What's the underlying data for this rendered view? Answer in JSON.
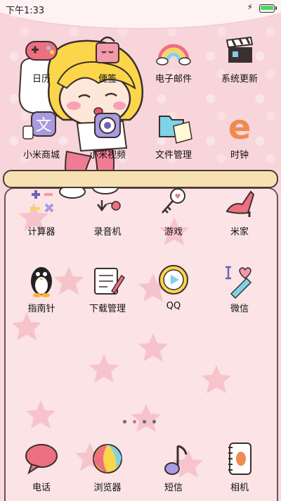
{
  "status_bar": {
    "time": "下午1:33",
    "battery_level": 1.0,
    "charging_icon": "flash-icon"
  },
  "apps_top": [
    {
      "label": "日历",
      "icon": "gamepad-icon"
    },
    {
      "label": "便签",
      "icon": "shopping-bag-icon"
    },
    {
      "label": "电子邮件",
      "icon": "rainbow-icon"
    },
    {
      "label": "系统更新",
      "icon": "clapperboard-icon"
    },
    {
      "label": "小米商城",
      "icon": "translate-icon"
    },
    {
      "label": "小米视频",
      "icon": "camera-icon"
    },
    {
      "label": "文件管理",
      "icon": "folder-icon"
    },
    {
      "label": "时钟",
      "icon": "letter-e-icon"
    }
  ],
  "apps_card": [
    {
      "label": "计算器",
      "icon": "math-symbols-icon"
    },
    {
      "label": "录音机",
      "icon": "arrow-tag-icon"
    },
    {
      "label": "游戏",
      "icon": "heart-key-icon"
    },
    {
      "label": "米家",
      "icon": "high-heel-icon"
    },
    {
      "label": "指南针",
      "icon": "penguin-icon"
    },
    {
      "label": "下载管理",
      "icon": "notepad-pencil-icon"
    },
    {
      "label": "QQ",
      "icon": "play-circle-icon"
    },
    {
      "label": "微信",
      "icon": "i-love-pencil-icon"
    }
  ],
  "page_indicator": {
    "pages": 4,
    "current": 2
  },
  "dock": [
    {
      "label": "电话",
      "icon": "speech-bubble-icon"
    },
    {
      "label": "浏览器",
      "icon": "beach-ball-icon"
    },
    {
      "label": "短信",
      "icon": "music-note-icon"
    },
    {
      "label": "相机",
      "icon": "notebook-icon"
    }
  ],
  "colors": {
    "background": "#f8d5da",
    "card": "#fbe3e6",
    "accent": "#e56b79"
  }
}
